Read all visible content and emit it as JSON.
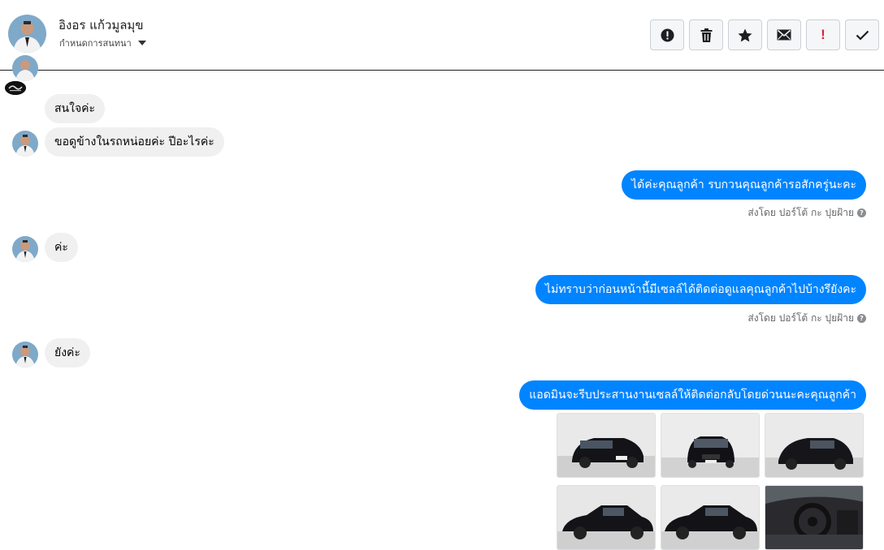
{
  "header": {
    "contact_name": "อิงอร แก้วมูลมุข",
    "subtitle": "กำหนดการสนทนา",
    "actions": [
      {
        "name": "report-button",
        "icon": "alert-circle-icon"
      },
      {
        "name": "delete-button",
        "icon": "trash-icon"
      },
      {
        "name": "star-button",
        "icon": "star-icon"
      },
      {
        "name": "mark-unread-button",
        "icon": "envelope-icon"
      },
      {
        "name": "important-button",
        "icon": "exclamation-icon",
        "label": "!"
      },
      {
        "name": "done-button",
        "icon": "check-icon"
      }
    ]
  },
  "messages": {
    "in_1": "สนใจค่ะ",
    "in_2": "ขอดูข้างในรถหน่อยค่ะ ปีอะไรค่ะ",
    "out_1": "ได้ค่ะคุณลูกค้า รบกวนคุณลูกค้ารอสักครู่นะคะ",
    "out_1_sender": "ส่งโดย ปอร์โต้ กะ ปุยฝ้าย",
    "in_3": "ค่ะ",
    "out_2": "ไม่ทราบว่าก่อนหน้านี้มีเซลล์ได้ติดต่อดูแลคุณลูกค้าไปบ้างรึยังคะ",
    "out_2_sender": "ส่งโดย ปอร์โต้ กะ ปุยฝ้าย",
    "in_4": "ยังค่ะ",
    "out_3": "แอดมินจะรีบประสานงานเซลล์ให้ติดต่อกลับโดยด่วนนะคะคุณลูกค้า"
  },
  "photos": [
    {
      "name": "car-photo-front-left"
    },
    {
      "name": "car-photo-front"
    },
    {
      "name": "car-photo-rear-left"
    },
    {
      "name": "car-photo-side"
    },
    {
      "name": "car-photo-side-2"
    },
    {
      "name": "car-photo-interior"
    }
  ],
  "colors": {
    "outgoing_bubble": "#0084ff",
    "incoming_bubble": "#f0f0f0",
    "important": "#e41e3f"
  }
}
